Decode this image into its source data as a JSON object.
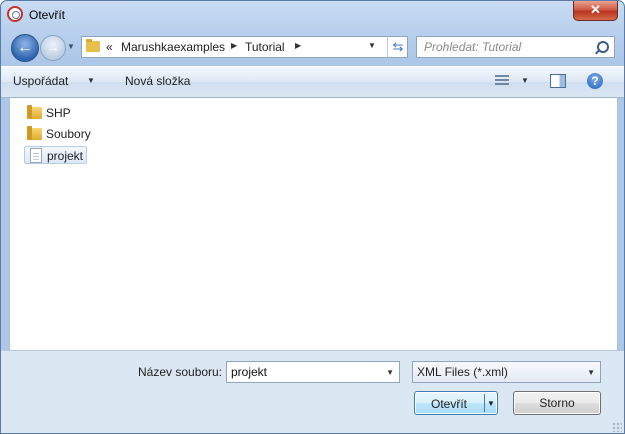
{
  "window": {
    "title": "Otevřít",
    "close_glyph": "✕"
  },
  "nav": {
    "back_glyph": "←",
    "forward_glyph": "→",
    "dropdown_glyph": "▼",
    "address": {
      "more_glyph": "«",
      "crumbs": [
        "Marushkaexamples",
        "Tutorial"
      ],
      "separator_glyph": "▶",
      "dropdown_glyph": "▼",
      "refresh_glyph": "⇆"
    },
    "search": {
      "placeholder": "Prohledat: Tutorial"
    }
  },
  "toolbar": {
    "organize_label": "Uspořádat",
    "organize_arrow": "▼",
    "new_folder_label": "Nová složka",
    "view_arrow": "▼",
    "help_glyph": "?"
  },
  "files": [
    {
      "name": "SHP",
      "type": "folder",
      "selected": false
    },
    {
      "name": "Soubory",
      "type": "folder",
      "selected": false
    },
    {
      "name": "projekt",
      "type": "file",
      "selected": true
    }
  ],
  "footer": {
    "filename_label": "Název souboru:",
    "filename_value": "projekt",
    "filename_dropdown_glyph": "▼",
    "filetype_value": "XML Files (*.xml)",
    "filetype_dropdown_glyph": "▼",
    "open_label": "Otevřít",
    "open_dropdown_glyph": "▼",
    "cancel_label": "Storno"
  }
}
